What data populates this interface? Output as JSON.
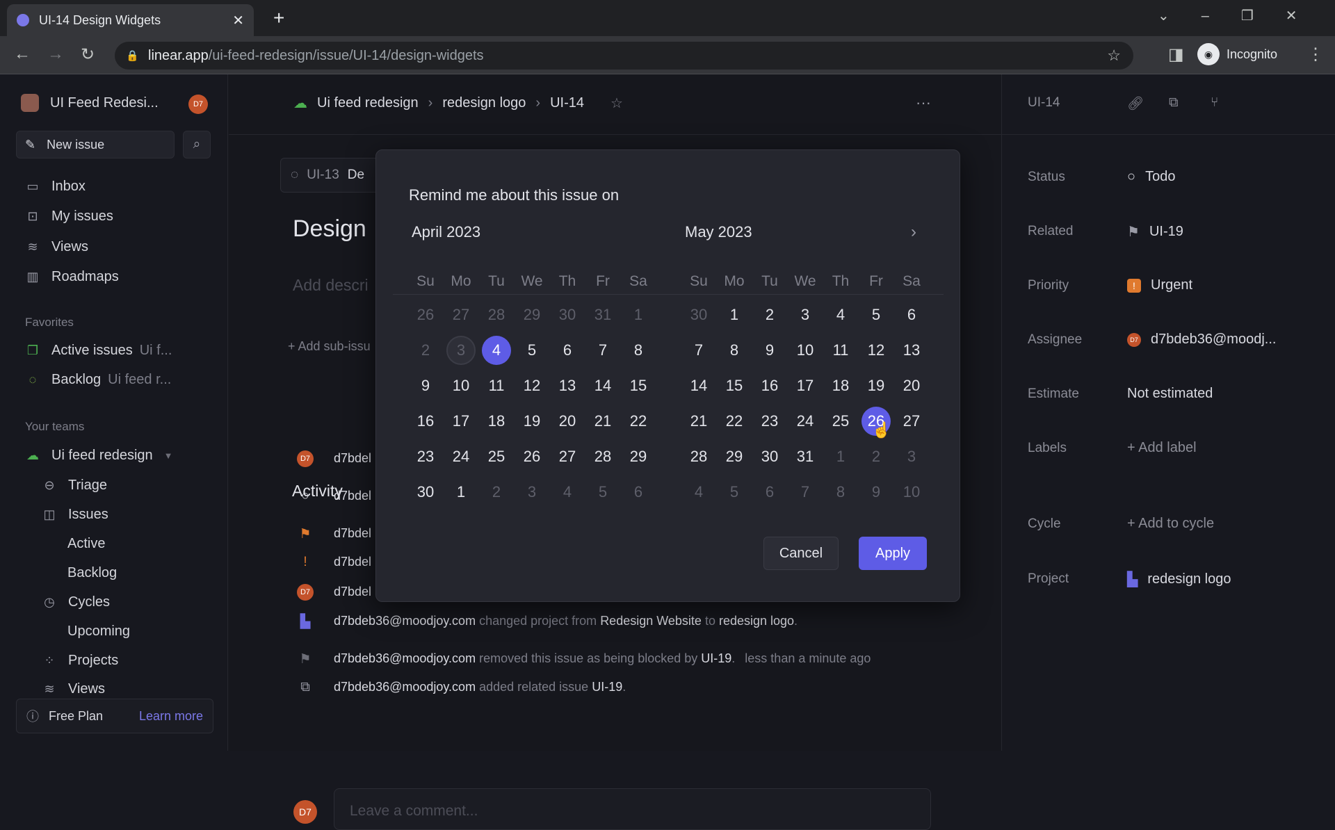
{
  "browser": {
    "tab_title": "UI-14 Design Widgets",
    "url_host": "linear.app",
    "url_path": "/ui-feed-redesign/issue/UI-14/design-widgets",
    "profile": "Incognito"
  },
  "sidebar": {
    "workspace": "UI Feed Redesi...",
    "avatar": "D7",
    "new_issue": "New issue",
    "nav": [
      {
        "label": "Inbox",
        "icon": "inbox-icon"
      },
      {
        "label": "My issues",
        "icon": "my-issues-icon"
      },
      {
        "label": "Views",
        "icon": "layers-icon"
      },
      {
        "label": "Roadmaps",
        "icon": "map-icon"
      }
    ],
    "favorites_heading": "Favorites",
    "favorites": [
      {
        "label": "Active issues",
        "sub": "Ui f..."
      },
      {
        "label": "Backlog",
        "sub": "Ui feed r..."
      }
    ],
    "teams_heading": "Your teams",
    "team": "Ui feed redesign",
    "team_items": [
      "Triage",
      "Issues",
      "Active",
      "Backlog",
      "Cycles",
      "Upcoming",
      "Projects",
      "Views"
    ],
    "free_plan": "Free Plan",
    "learn_more": "Learn more"
  },
  "main": {
    "breadcrumb": [
      "Ui feed redesign",
      "redesign logo",
      "UI-14"
    ],
    "parent_id": "UI-13",
    "parent_title": "De",
    "title": "Design",
    "description_placeholder": "Add descri",
    "add_sub_issue": "+ Add sub-issu",
    "activity_heading": "Activity",
    "activity_truncated": [
      "d7bdel",
      "d7bdel",
      "d7bdel",
      "d7bdel",
      "d7bdel"
    ],
    "activity": [
      {
        "user": "d7bdeb36@moodjoy.com",
        "text1": " changed project from ",
        "ref1": "Redesign Website",
        "text2": " to ",
        "ref2": "redesign logo",
        "text3": ".",
        "time": ""
      },
      {
        "user": "d7bdeb36@moodjoy.com",
        "text1": " removed this issue as being blocked by ",
        "ref1": "UI-19",
        "text2": ".",
        "ref2": "",
        "text3": "",
        "time": "less than a minute ago"
      },
      {
        "user": "d7bdeb36@moodjoy.com",
        "text1": " added related issue ",
        "ref1": "UI-19",
        "text2": ".",
        "ref2": "",
        "text3": "",
        "time": ""
      }
    ],
    "comment_placeholder": "Leave a comment..."
  },
  "right": {
    "issue_id": "UI-14",
    "rows": [
      {
        "label": "Status",
        "value": "Todo"
      },
      {
        "label": "Related",
        "value": "UI-19"
      },
      {
        "label": "Priority",
        "value": "Urgent"
      },
      {
        "label": "Assignee",
        "value": "d7bdeb36@moodj..."
      },
      {
        "label": "Estimate",
        "value": "Not estimated"
      },
      {
        "label": "Labels",
        "value": "+ Add label"
      },
      {
        "label": "Cycle",
        "value": "+ Add to cycle"
      },
      {
        "label": "Project",
        "value": "redesign logo"
      }
    ]
  },
  "modal": {
    "title": "Remind me about this issue on",
    "weekdays": [
      "Su",
      "Mo",
      "Tu",
      "We",
      "Th",
      "Fr",
      "Sa"
    ],
    "months": [
      {
        "name": "April 2023",
        "days": [
          26,
          27,
          28,
          29,
          30,
          31,
          1,
          2,
          3,
          4,
          5,
          6,
          7,
          8,
          9,
          10,
          11,
          12,
          13,
          14,
          15,
          16,
          17,
          18,
          19,
          20,
          21,
          22,
          23,
          24,
          25,
          26,
          27,
          28,
          29,
          30,
          1,
          2,
          3,
          4,
          5,
          6
        ],
        "first_current": 9,
        "last_current": 36,
        "selected": 9,
        "today": 8
      },
      {
        "name": "May 2023",
        "days": [
          30,
          1,
          2,
          3,
          4,
          5,
          6,
          7,
          8,
          9,
          10,
          11,
          12,
          13,
          14,
          15,
          16,
          17,
          18,
          19,
          20,
          21,
          22,
          23,
          24,
          25,
          26,
          27,
          28,
          29,
          30,
          31,
          1,
          2,
          3,
          4,
          5,
          6,
          7,
          8,
          9,
          10
        ],
        "first_current": 1,
        "last_current": 31,
        "selected": 26,
        "today": -1
      }
    ],
    "cancel": "Cancel",
    "apply": "Apply",
    "accent": "#5e5ce6"
  }
}
